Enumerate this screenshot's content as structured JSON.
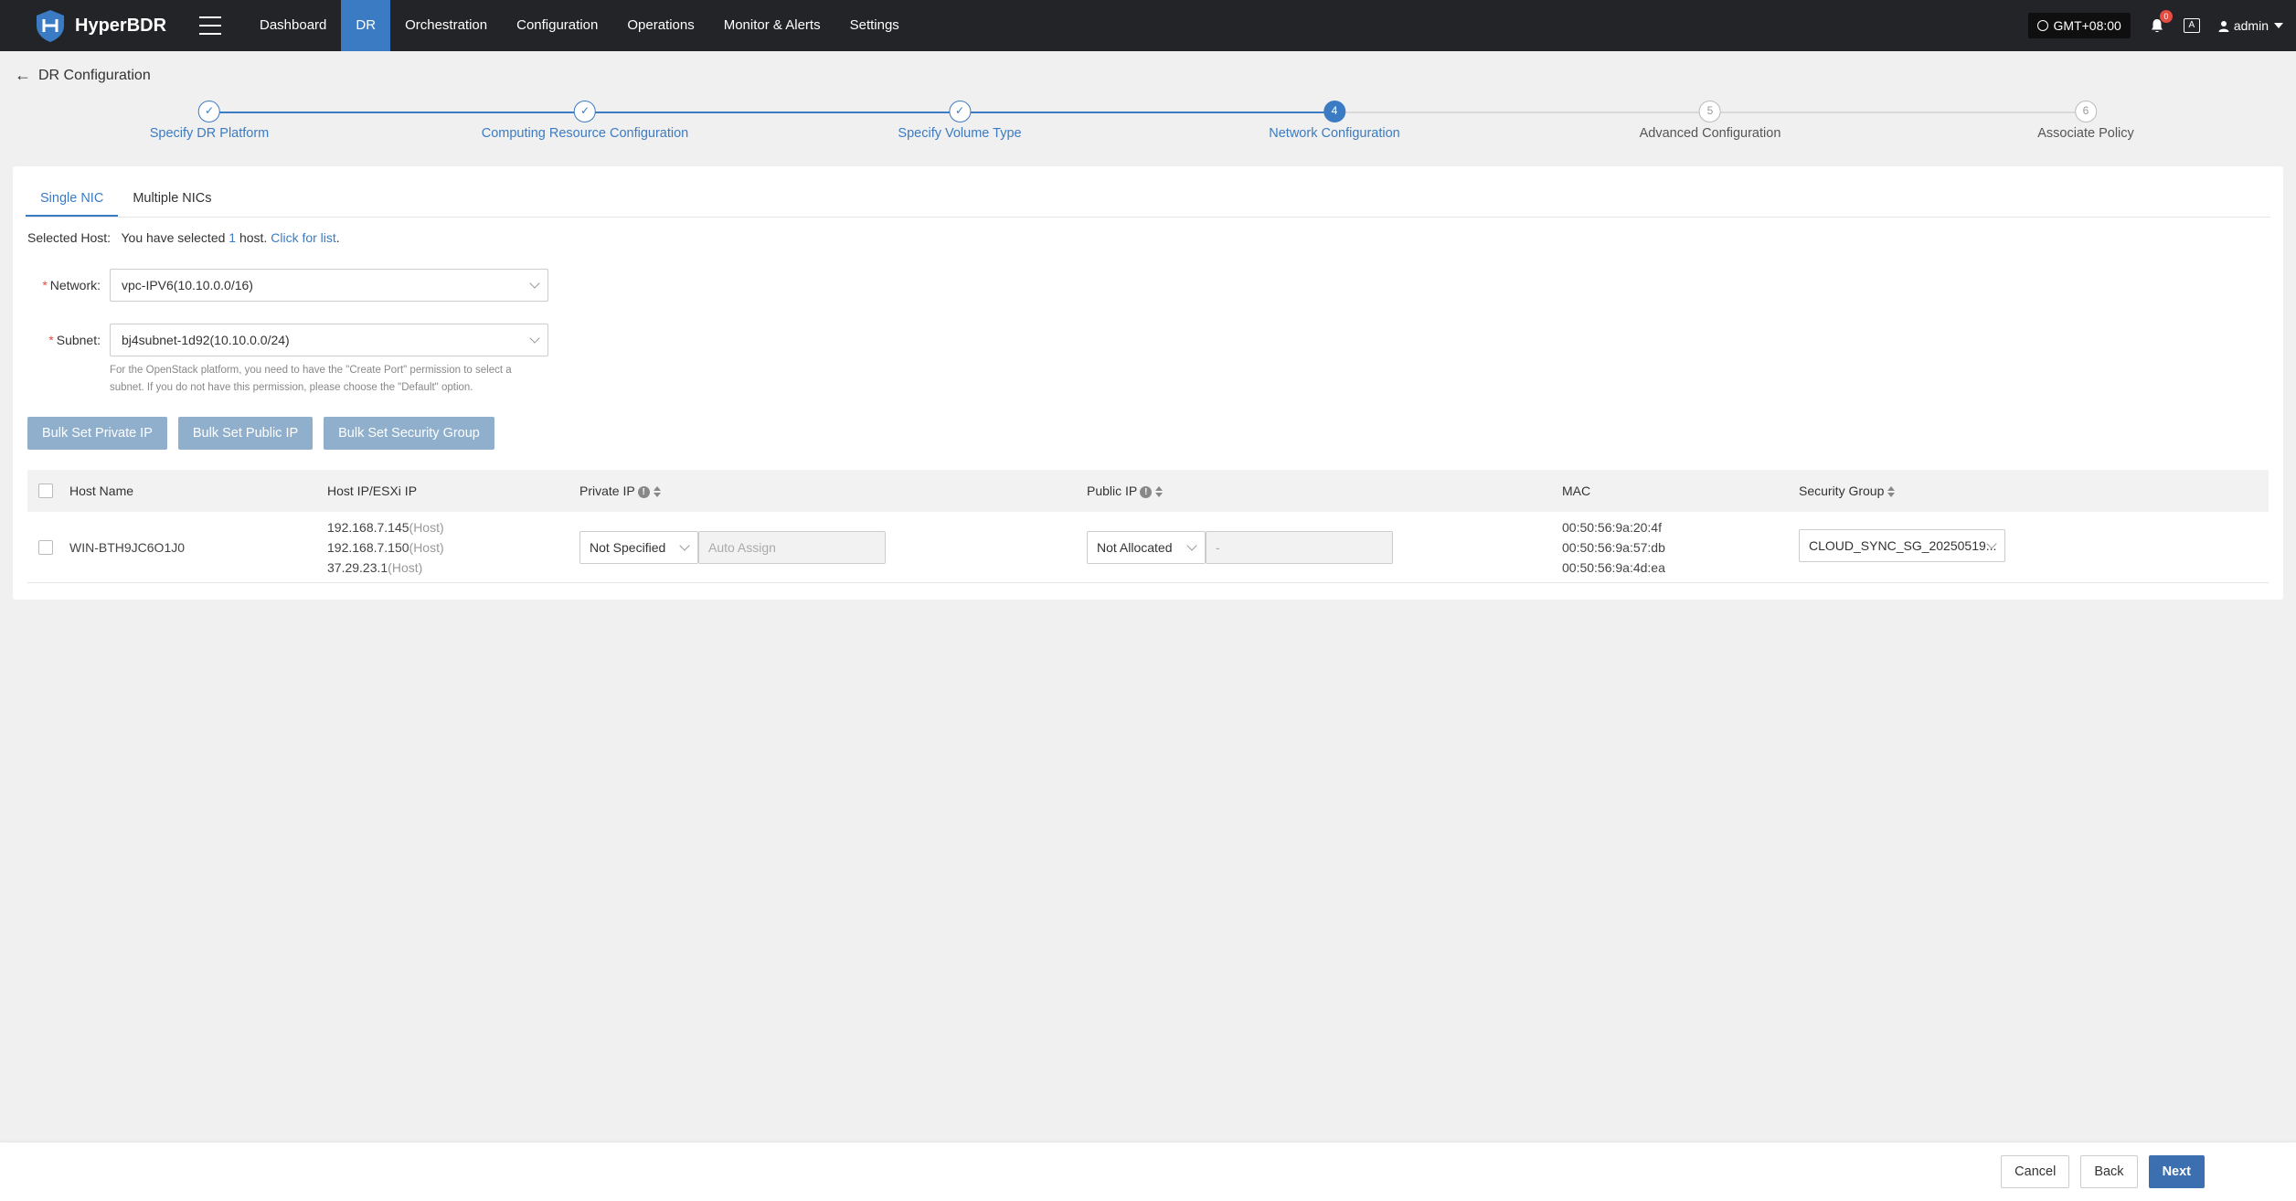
{
  "app": {
    "name": "HyperBDR"
  },
  "nav": {
    "items": [
      {
        "label": "Dashboard",
        "active": false
      },
      {
        "label": "DR",
        "active": true
      },
      {
        "label": "Orchestration",
        "active": false
      },
      {
        "label": "Configuration",
        "active": false
      },
      {
        "label": "Operations",
        "active": false
      },
      {
        "label": "Monitor & Alerts",
        "active": false
      },
      {
        "label": "Settings",
        "active": false
      }
    ],
    "timezone": "GMT+08:00",
    "notification_count": "0",
    "lang_icon": "A",
    "user": "admin"
  },
  "page": {
    "title": "DR Configuration"
  },
  "steps": [
    {
      "number": "1",
      "label": "Specify DR Platform",
      "status": "done"
    },
    {
      "number": "2",
      "label": "Computing Resource Configuration",
      "status": "done"
    },
    {
      "number": "3",
      "label": "Specify Volume Type",
      "status": "done"
    },
    {
      "number": "4",
      "label": "Network Configuration",
      "status": "active"
    },
    {
      "number": "5",
      "label": "Advanced Configuration",
      "status": "todo"
    },
    {
      "number": "6",
      "label": "Associate Policy",
      "status": "todo"
    }
  ],
  "tabs": [
    {
      "label": "Single NIC",
      "active": true
    },
    {
      "label": "Multiple NICs",
      "active": false
    }
  ],
  "selected_host": {
    "label": "Selected Host:",
    "text_before": "You have selected",
    "count": "1",
    "text_after": "host.",
    "link": "Click for list",
    "period": "."
  },
  "form": {
    "network_label": "Network:",
    "network_value": "vpc-IPV6(10.10.0.0/16)",
    "subnet_label": "Subnet:",
    "subnet_value": "bj4subnet-1d92(10.10.0.0/24)",
    "hint": "For the OpenStack platform, you need to have the \"Create Port\" permission to select a subnet. If you do not have this permission, please choose the \"Default\" option."
  },
  "bulk_buttons": [
    "Bulk Set Private IP",
    "Bulk Set Public IP",
    "Bulk Set Security Group"
  ],
  "table": {
    "headers": {
      "host_name": "Host Name",
      "host_ip": "Host IP/ESXi IP",
      "private_ip": "Private IP",
      "public_ip": "Public IP",
      "mac": "MAC",
      "security_group": "Security Group"
    },
    "rows": [
      {
        "host_name": "WIN-BTH9JC6O1J0",
        "ips": [
          {
            "ip": "192.168.7.145",
            "tag": "(Host)"
          },
          {
            "ip": "192.168.7.150",
            "tag": "(Host)"
          },
          {
            "ip": "37.29.23.1",
            "tag": "(Host)"
          }
        ],
        "private_ip_mode": "Not Specified",
        "private_ip_placeholder": "Auto Assign",
        "public_ip_mode": "Not Allocated",
        "public_ip_placeholder": "-",
        "macs": [
          "00:50:56:9a:20:4f",
          "00:50:56:9a:57:db",
          "00:50:56:9a:4d:ea"
        ],
        "security_group": "CLOUD_SYNC_SG_20250519..."
      }
    ]
  },
  "footer": {
    "cancel": "Cancel",
    "back": "Back",
    "next": "Next"
  },
  "colors": {
    "primary": "#3b7bc4",
    "topbar": "#232428",
    "bulk_button": "#8fafcc"
  }
}
